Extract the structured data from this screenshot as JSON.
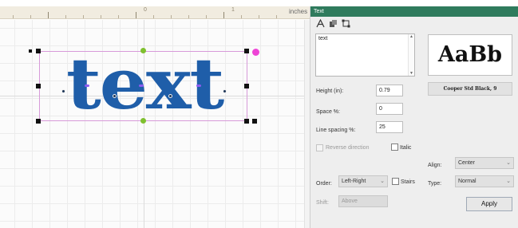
{
  "ruler": {
    "numbers": [
      "0",
      "1"
    ],
    "units": "inches"
  },
  "canvas": {
    "text_object": "text"
  },
  "panel": {
    "title": "Text",
    "text_value": "text",
    "preview_sample": "AaBb",
    "font_name": "Cooper Std Black, 9",
    "height": {
      "label": "Height (in):",
      "value": "0.79"
    },
    "space": {
      "label": "Space %:",
      "value": "0"
    },
    "line_spacing": {
      "label": "Line spacing %:",
      "value": "25"
    },
    "reverse_direction": "Reverse direction",
    "italic": "Italic",
    "align": {
      "label": "Align:",
      "value": "Center"
    },
    "order": {
      "label": "Order:",
      "value": "Left-Right"
    },
    "stairs": "Stairs",
    "type": {
      "label": "Type:",
      "value": "Normal"
    },
    "shift": {
      "label": "Shift:",
      "value": "Above"
    },
    "apply": "Apply"
  },
  "colors": {
    "text_fill": "#1f5ea9",
    "panel_title_bar": "#2f7b5d",
    "selection_border": "#d79ad9",
    "rotate_handle": "#ee44d6"
  }
}
